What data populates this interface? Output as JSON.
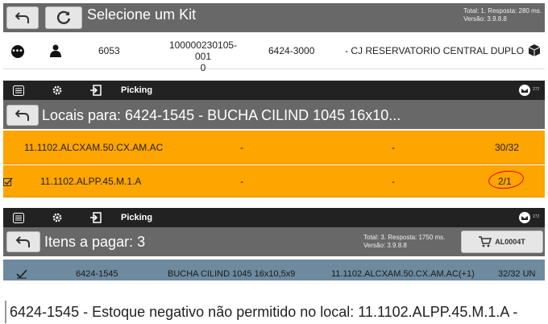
{
  "panel1": {
    "title": "Selecione um Kit",
    "stats_line1": "Total: 1. Resposta: 280 ms.",
    "stats_line2": "Versão: 3.9.8.8",
    "row": {
      "code": "6053",
      "doc_line1": "100000230105-001",
      "doc_line2": "0",
      "product": "6424-3000",
      "description": "- CJ RESERVATORIO CENTRAL DUPLO"
    }
  },
  "panel2": {
    "nav_label": "Picking",
    "badge": "272",
    "title": "Locais para: 6424-1545 - BUCHA CILIND 1045 16x10...",
    "rows": [
      {
        "location": "11.1102.ALCXAM.50.CX.AM.AC",
        "col2": "-",
        "col3": "-",
        "qty": "30/32"
      },
      {
        "location": "11.1102.ALPP.45.M.1.A",
        "col2": "-",
        "col3": "-",
        "qty": "2/1"
      }
    ]
  },
  "panel3": {
    "nav_label": "Picking",
    "badge": "272",
    "title": "Itens a pagar: 3",
    "stats_line1": "Total: 3. Resposta: 1750 ms.",
    "stats_line2": "Versão: 3.9.8.8",
    "cart_label": "AL0004T",
    "row": {
      "product": "6424-1545",
      "description": "BUCHA CILIND 1045 16x10,5x9",
      "location": "11.1102.ALCXAM.50.CX.AM.AC(+1)",
      "qty": "32/32 UN"
    }
  },
  "message": "6424-1545 - Estoque negativo não permitido no local: 11.1102.ALPP.45.M.1.A -",
  "colors": {
    "titlebar": "#686868",
    "navbar": "#222222",
    "orange_row": "#ffa500",
    "selected_row": "#6e8a9e",
    "annotation": "#e00000"
  }
}
